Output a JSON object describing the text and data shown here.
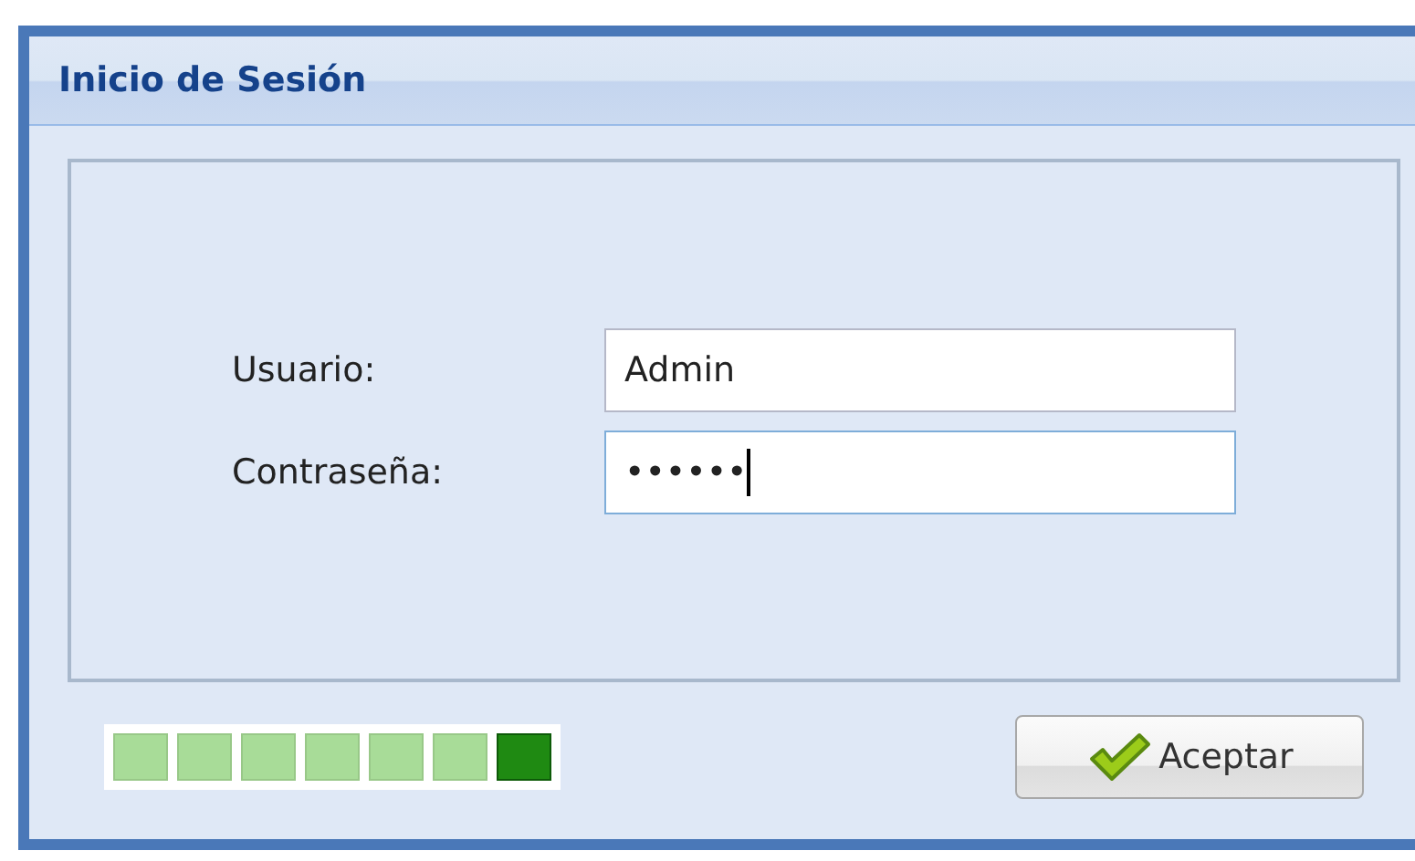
{
  "window": {
    "title": "Inicio de Sesión"
  },
  "fields": [
    {
      "label": "Usuario:",
      "value": "Admin",
      "focused": false
    },
    {
      "label": "Contraseña:",
      "value": "••••••",
      "focused": true
    }
  ],
  "wait_indicator": {
    "segments": [
      {
        "on": false
      },
      {
        "on": false
      },
      {
        "on": false
      },
      {
        "on": false
      },
      {
        "on": false
      },
      {
        "on": false
      },
      {
        "on": true
      }
    ]
  },
  "buttons": [
    {
      "label": "Aceptar"
    }
  ]
}
